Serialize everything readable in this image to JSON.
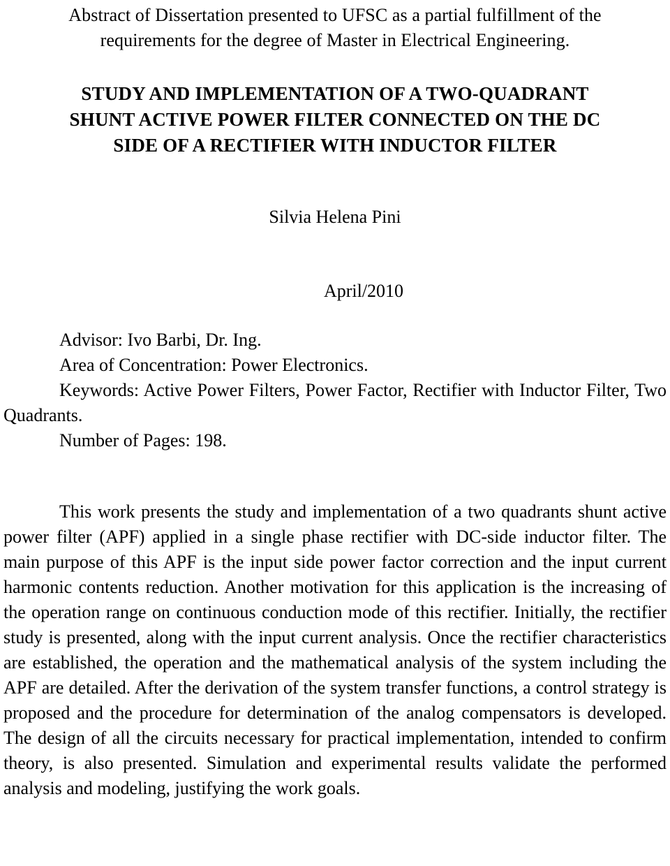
{
  "page": {
    "background_color": "#ffffff",
    "text_color": "#000000"
  },
  "header": {
    "line1": "Abstract of Dissertation presented to UFSC as a partial fulfillment of the",
    "line2": "requirements for the degree of Master in Electrical Engineering."
  },
  "title": {
    "line1": "STUDY AND IMPLEMENTATION OF A TWO-QUADRANT",
    "line2": "SHUNT ACTIVE POWER FILTER CONNECTED ON THE DC",
    "line3": "SIDE OF A RECTIFIER WITH INDUCTOR FILTER"
  },
  "author": {
    "name": "Silvia Helena Pini"
  },
  "date": {
    "value": "April/2010"
  },
  "metadata": {
    "advisor": "Advisor: Ivo Barbi, Dr. Ing.",
    "area_of_concentration": "Area of Concentration: Power Electronics.",
    "keywords": "Keywords: Active Power Filters, Power Factor, Rectifier with Inductor Filter, Two Quadrants.",
    "number_of_pages": "Number of Pages: 198."
  },
  "abstract": {
    "text": "This work presents the study and implementation of a two quadrants shunt active power filter (APF) applied in a single phase rectifier with DC-side inductor filter. The main purpose of this APF is the input side power factor correction and the input current harmonic contents reduction. Another motivation for this application is the increasing of the operation range on continuous conduction mode of this rectifier. Initially, the rectifier study is presented, along with the input current analysis. Once the rectifier characteristics are established, the operation and the mathematical analysis of the system including the APF are detailed. After the derivation of the system transfer functions, a control strategy is proposed and the procedure for determination of the analog compensators is developed. The design of all the circuits necessary for practical implementation, intended to confirm theory, is also presented. Simulation and experimental results validate the performed analysis and modeling, justifying the work goals."
  }
}
